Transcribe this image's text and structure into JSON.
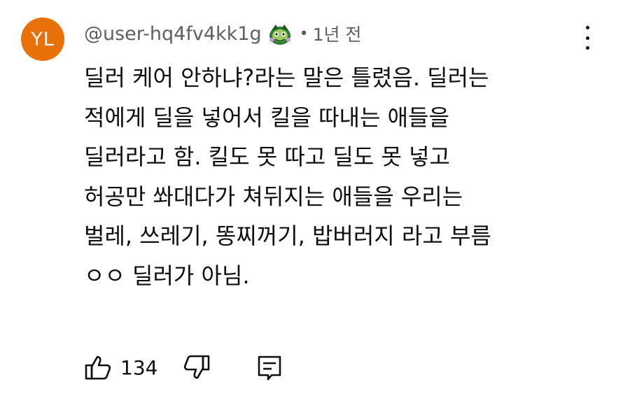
{
  "comment": {
    "avatar_initials": "YL",
    "avatar_color": "#e8710a",
    "handle": "@user-hq4fv4kk1g",
    "badge_icon": "member-badge-icon",
    "separator": "•",
    "timestamp": "1년 전",
    "body_lines": [
      "딜러 케어 안하냐?라는 말은 틀렸음. 딜러는",
      "적에게 딜을 넣어서 킬을 따내는 애들을",
      "딜러라고 함. 킬도 못 따고 딜도 못 넣고",
      "허공만 쏴대다가 쳐뒤지는 애들을 우리는",
      "벌레, 쓰레기, 똥찌꺼기, 밥버러지 라고 부름",
      "ㅇㅇ 딜러가 아님."
    ],
    "like_count": "134",
    "icons": {
      "like": "thumbs-up-icon",
      "dislike": "thumbs-down-icon",
      "reply": "reply-icon",
      "more": "more-vertical-icon"
    }
  }
}
